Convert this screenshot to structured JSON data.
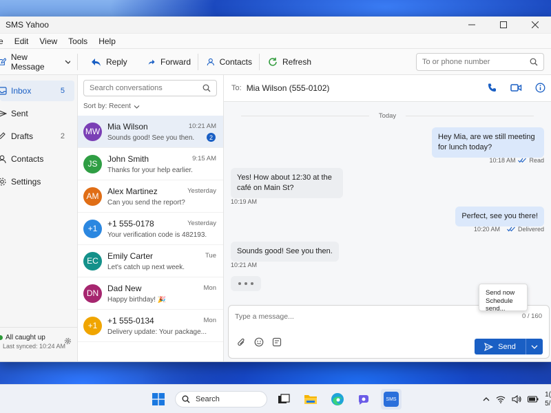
{
  "window": {
    "title": "SMS Yahoo",
    "controls": {
      "minimize": "—",
      "maximize": "☐",
      "close": "✕"
    }
  },
  "menu": [
    "e",
    "Edit",
    "View",
    "Tools",
    "Help"
  ],
  "toolbar": {
    "new_message": "New Message",
    "reply": "Reply",
    "forward": "Forward",
    "contacts": "Contacts",
    "refresh": "Refresh",
    "search_placeholder": "To or phone number"
  },
  "sidebar": {
    "items": [
      {
        "label": "Inbox",
        "count": "5",
        "icon": "inbox-icon"
      },
      {
        "label": "Sent",
        "count": "",
        "icon": "send-icon"
      },
      {
        "label": "Drafts",
        "count": "2",
        "icon": "drafts-icon"
      },
      {
        "label": "Contacts",
        "count": "",
        "icon": "person-icon"
      },
      {
        "label": "Settings",
        "count": "",
        "icon": "gear-icon"
      }
    ],
    "status": "All caught up",
    "last_synced": "Last synced: 10:24 AM"
  },
  "conversations": {
    "search_placeholder": "Search conversations",
    "sort_label": "Sort by: Recent",
    "items": [
      {
        "initials": "MW",
        "name": "Mia Wilson",
        "preview": "Sounds good! See you then.",
        "time": "10:21 AM",
        "unread": "2",
        "color": "#7a3fb5"
      },
      {
        "initials": "JS",
        "name": "John Smith",
        "preview": "Thanks for your help earlier.",
        "time": "9:15 AM",
        "unread": "",
        "color": "#2f9e44"
      },
      {
        "initials": "AM",
        "name": "Alex Martinez",
        "preview": "Can you send the report?",
        "time": "Yesterday",
        "unread": "",
        "color": "#e06e16"
      },
      {
        "initials": "+1",
        "name": "+1 555-0178",
        "preview": "Your verification code is 482193.",
        "time": "Yesterday",
        "unread": "",
        "color": "#2b87e0"
      },
      {
        "initials": "EC",
        "name": "Emily Carter",
        "preview": "Let's catch up next week.",
        "time": "Tue",
        "unread": "",
        "color": "#14918a"
      },
      {
        "initials": "DN",
        "name": "Dad New",
        "preview": "Happy birthday! 🎉",
        "time": "Mon",
        "unread": "",
        "color": "#a6266f"
      },
      {
        "initials": "+1",
        "name": "+1 555-0134",
        "preview": "Delivery update: Your package...",
        "time": "Mon",
        "unread": "",
        "color": "#f0a500"
      }
    ]
  },
  "chat": {
    "to_label": "To:",
    "recipient": "Mia Wilson (555-0102)",
    "day_label": "Today",
    "messages": [
      {
        "dir": "out",
        "text": "Hey Mia, are we still meeting for lunch today?",
        "time": "10:18 AM",
        "status": "Read"
      },
      {
        "dir": "in",
        "text": "Yes! How about 12:30 at the café on Main St?",
        "time": "10:19 AM",
        "status": ""
      },
      {
        "dir": "out",
        "text": "Perfect, see you there!",
        "time": "10:20 AM",
        "status": "Delivered"
      },
      {
        "dir": "in",
        "text": "Sounds good! See you then.",
        "time": "10:21 AM",
        "status": ""
      }
    ],
    "composer_placeholder": "Type a message...",
    "counter": "0 / 160",
    "send_label": "Send",
    "send_options": [
      "Send now",
      "Schedule send..."
    ]
  },
  "taskbar": {
    "search_label": "Search",
    "app_label": "SMS",
    "clock_time": "1(",
    "clock_date": "5/"
  },
  "colors": {
    "accent": "#1a5fc4",
    "out_bubble": "#dbe8fb",
    "in_bubble": "#eceef1"
  }
}
